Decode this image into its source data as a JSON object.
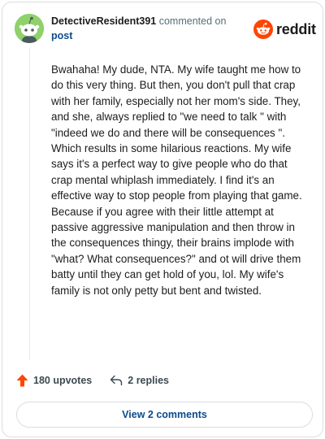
{
  "comment": {
    "username": "DetectiveResident391",
    "commented_on": "commented on",
    "post_link": "post",
    "body": "Bwahaha! My dude, NTA. My wife taught me how to do this very thing. But then, you don't pull that crap with her family, especially not her mom's side. They, and she, always replied to \"we need to talk \" with \"indeed we do and there will be consequences \". Which results in some hilarious reactions. My wife says it's a perfect way to give people who do that crap mental whiplash immediately. I find it's an effective way to stop people from playing that game. Because if you agree with their little attempt at passive aggressive manipulation and then throw in the consequences thingy, their brains implode with \"what? What consequences?\" and ot will drive them batty until they can get hold of you, lol. My wife's family is not only petty but bent and twisted.",
    "upvotes": "180 upvotes",
    "replies": "2 replies"
  },
  "branding": {
    "logo_text": "reddit",
    "brand_color": "#FF4500"
  },
  "view_comments_label": "View 2 comments",
  "icons": {
    "avatar": "snoo-avatar-icon",
    "logo": "reddit-snoo-icon",
    "upvote": "upvote-arrow-icon",
    "reply": "reply-arrow-icon"
  }
}
